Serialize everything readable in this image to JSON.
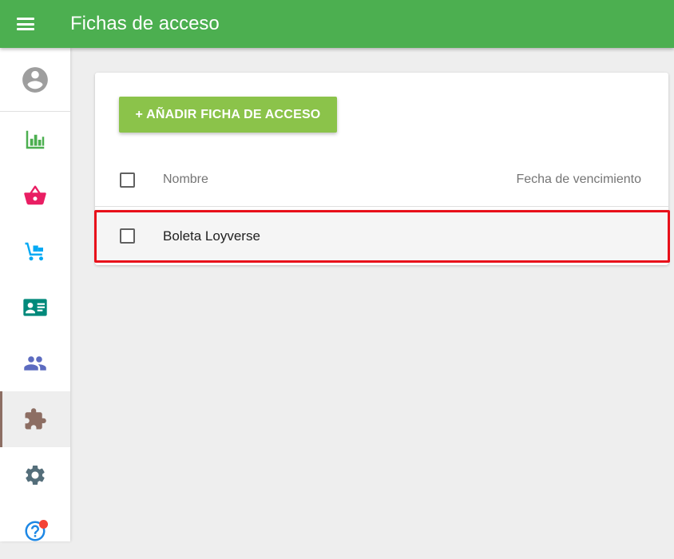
{
  "header": {
    "title": "Fichas de acceso",
    "background_color": "#4caf50",
    "menu_icon": "hamburger-menu-icon"
  },
  "sidebar": {
    "items": [
      {
        "name": "profile",
        "icon": "account-circle-icon",
        "color": "#9e9e9e"
      },
      {
        "name": "reports",
        "icon": "bar-chart-icon",
        "color": "#4caf50"
      },
      {
        "name": "items",
        "icon": "basket-icon",
        "color": "#e91e63"
      },
      {
        "name": "inventory",
        "icon": "hand-truck-icon",
        "color": "#03a9f4"
      },
      {
        "name": "customers",
        "icon": "contact-card-icon",
        "color": "#00897b"
      },
      {
        "name": "employees",
        "icon": "people-icon",
        "color": "#5c6bc0"
      },
      {
        "name": "integrations",
        "icon": "puzzle-icon",
        "color": "#8d6e63",
        "active": true
      },
      {
        "name": "settings",
        "icon": "gear-icon",
        "color": "#546e7a"
      },
      {
        "name": "help",
        "icon": "help-icon",
        "color": "#1e88e5",
        "badge_color": "#f44336"
      }
    ]
  },
  "main": {
    "add_button_label": "+ AÑADIR FICHA DE ACCESO",
    "add_button_color": "#8bc34a",
    "table": {
      "columns": [
        "Nombre",
        "Fecha de vencimiento"
      ],
      "rows": [
        {
          "name": "Boleta Loyverse",
          "expiry": ""
        }
      ]
    }
  },
  "highlight_color": "#e8101a"
}
